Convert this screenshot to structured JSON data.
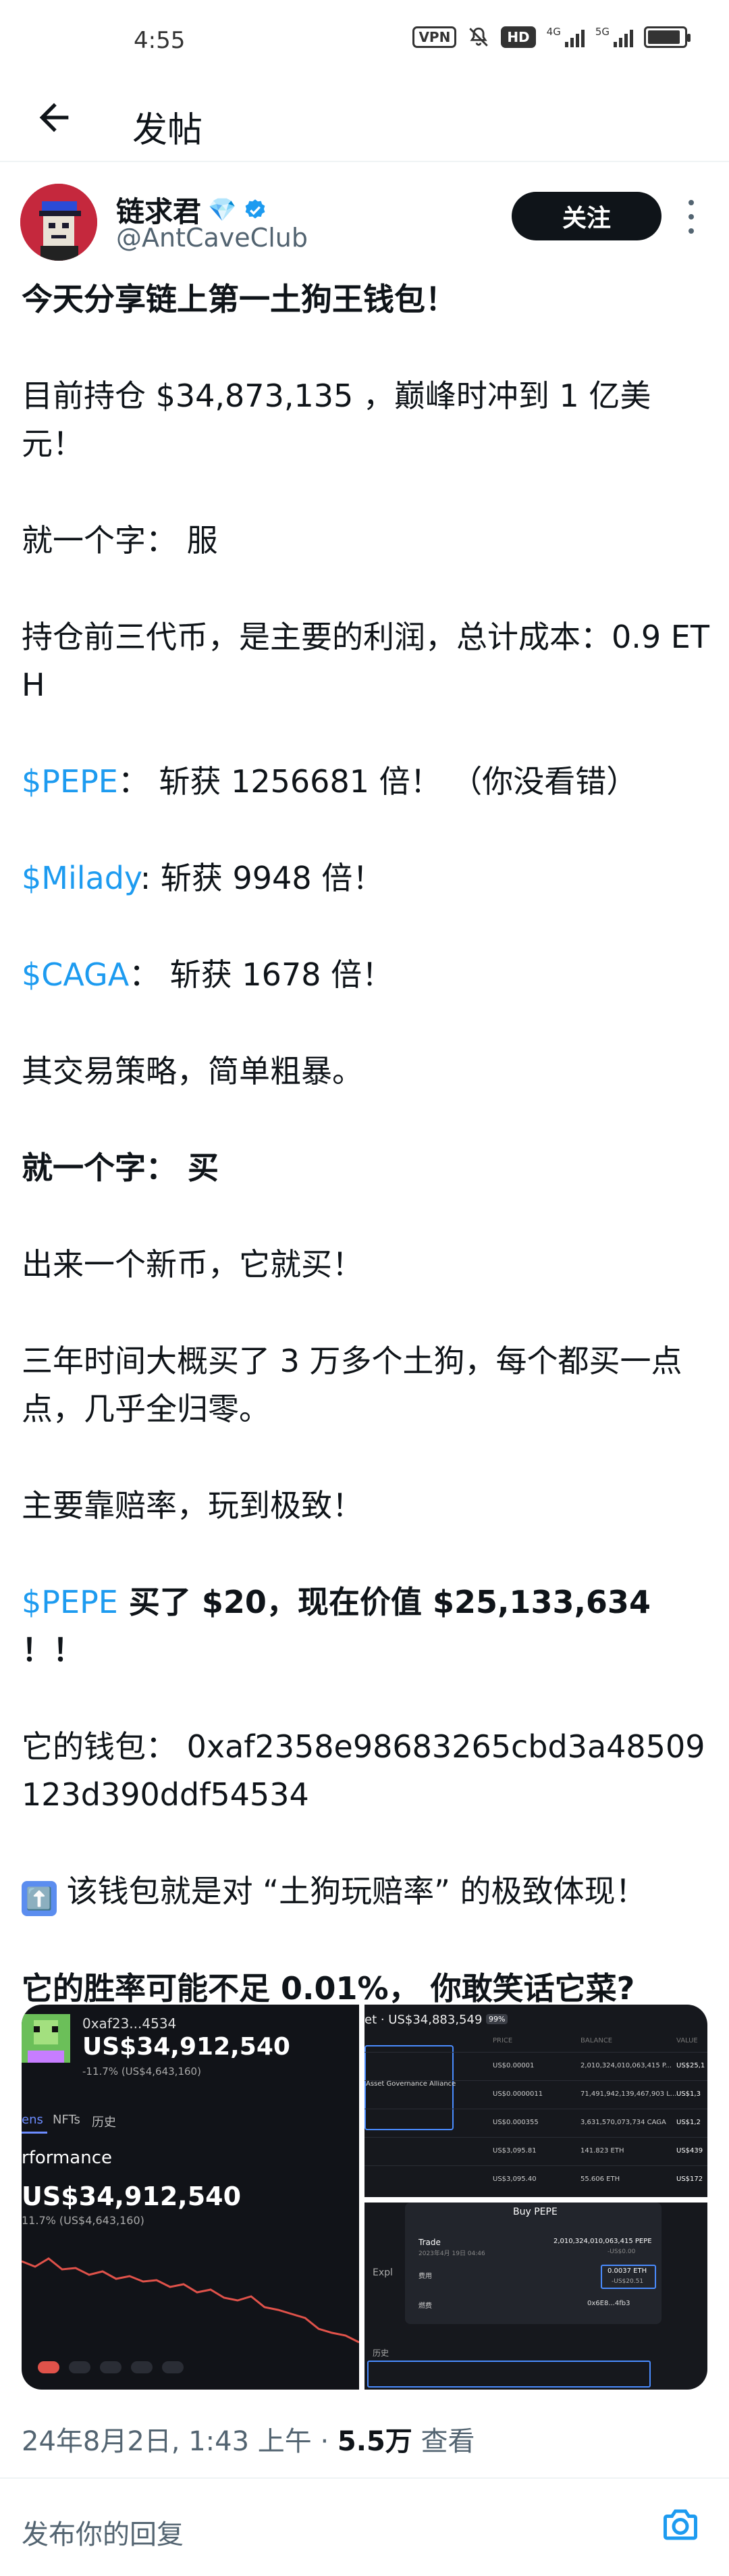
{
  "status_bar": {
    "time": "4:55",
    "vpn": "VPN",
    "hd": "HD",
    "net1": "4G",
    "net2": "5G",
    "battery_level": 0.9
  },
  "nav": {
    "title": "发帖"
  },
  "author": {
    "name": "链求君",
    "badge_emoji": "💎",
    "handle": "@AntCaveClub",
    "follow_label": "关注"
  },
  "post": {
    "p1": "今天分享链上第一土狗王钱包！",
    "p2": "目前持仓 $34,873,135 ，巅峰时冲到 1 亿美元！",
    "p3": "就一个字： 服",
    "p4": "持仓前三代币，是主要的利润，总计成本：0.9 ETH",
    "pepe_tag": "$PEPE",
    "p5_rest": "： 斩获 1256681 倍！ （你没看错）",
    "milady_tag": "$Milady",
    "p6_rest": ": 斩获 9948 倍！",
    "caga_tag": "$CAGA",
    "p7_rest": "： 斩获 1678 倍！",
    "p8": "其交易策略，简单粗暴。",
    "p9": "就一个字： 买",
    "p10": "出来一个新币，它就买！",
    "p11": "三年时间大概买了 3 万多个土狗，每个都买一点点，几乎全归零。",
    "p12": "主要靠赔率，玩到极致！",
    "pepe_tag2": "$PEPE",
    "p13_rest": " 买了 $20，现在价值 $25,133,634 ！！",
    "p14": "它的钱包： 0xaf2358e98683265cbd3a48509123d390ddf54534",
    "up_emoji": "⬆️",
    "p15": " 该钱包就是对 “土狗玩赔率” 的极致体现！",
    "p16": "它的胜率可能不足 0.01%， 你敢笑话它菜?"
  },
  "media": {
    "left": {
      "wallet": "0xaf23...4534",
      "balance": "US$34,912,540",
      "change": "-11.7% (US$4,643,160)",
      "tab1": "ens",
      "tab2": "NFTs",
      "tab3": "历史",
      "section": "rformance",
      "balance2": "US$34,912,540",
      "change2": "11.7% (US$4,643,160)"
    },
    "right_top": {
      "header": "et · US$34,883,549",
      "badge": "99%",
      "col1": "PRICE",
      "col2": "BALANCE",
      "col3": "VALUE",
      "alliance": "Asset Governance Alliance",
      "rows": [
        {
          "price": "US$0.00001",
          "bal": "2,010,324,010,063,415 P...",
          "val": "US$25,1"
        },
        {
          "price": "US$0.0000011",
          "bal": "71,491,942,139,467,903 L...",
          "val": "US$1,3"
        },
        {
          "price": "US$0.000355",
          "bal": "3,631,570,073,734 CAGA",
          "val": "US$1,2"
        },
        {
          "price": "US$3,095.81",
          "bal": "141.823 ETH",
          "val": "US$439"
        },
        {
          "price": "US$3,095.40",
          "bal": "55.606 ETH",
          "val": "US$172"
        }
      ]
    },
    "right_bottom": {
      "title": "Buy PEPE",
      "row1_label": "Trade",
      "row1_sub": "2023年4月 19日 04:46",
      "row1_val": "2,010,324,010,063,415 PEPE",
      "row1_sub2": "-US$0.00",
      "fee_label": "费用",
      "fee_val": "0.0037 ETH",
      "fee_sub": "-US$20.51",
      "gas_label": "燃费",
      "gas_val": "0x6E8...4fb3",
      "side_label": "Expl",
      "history": "历史"
    }
  },
  "footer": {
    "timestamp": "24年8月2日, 1:43 上午 · ",
    "views_num": "5.5万",
    "views_label": " 查看",
    "reply_placeholder": "发布你的回复"
  },
  "colors": {
    "link": "#1d9bf0",
    "follow_bg": "#0f1419",
    "muted": "#536471",
    "verified": "#1d9bf0"
  }
}
